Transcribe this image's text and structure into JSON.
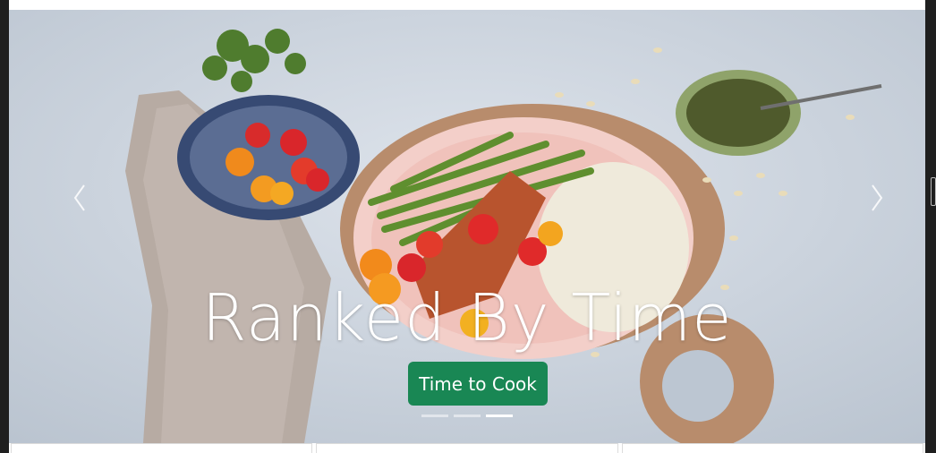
{
  "carousel": {
    "caption_title": "Ranked By Time",
    "button_label": "Time to Cook",
    "indicators": [
      {
        "active": false
      },
      {
        "active": false
      },
      {
        "active": true
      }
    ],
    "prev_icon": "chevron-left-icon",
    "next_icon": "chevron-right-icon"
  },
  "colors": {
    "button": "#198754",
    "background": "#c9d1dc"
  }
}
